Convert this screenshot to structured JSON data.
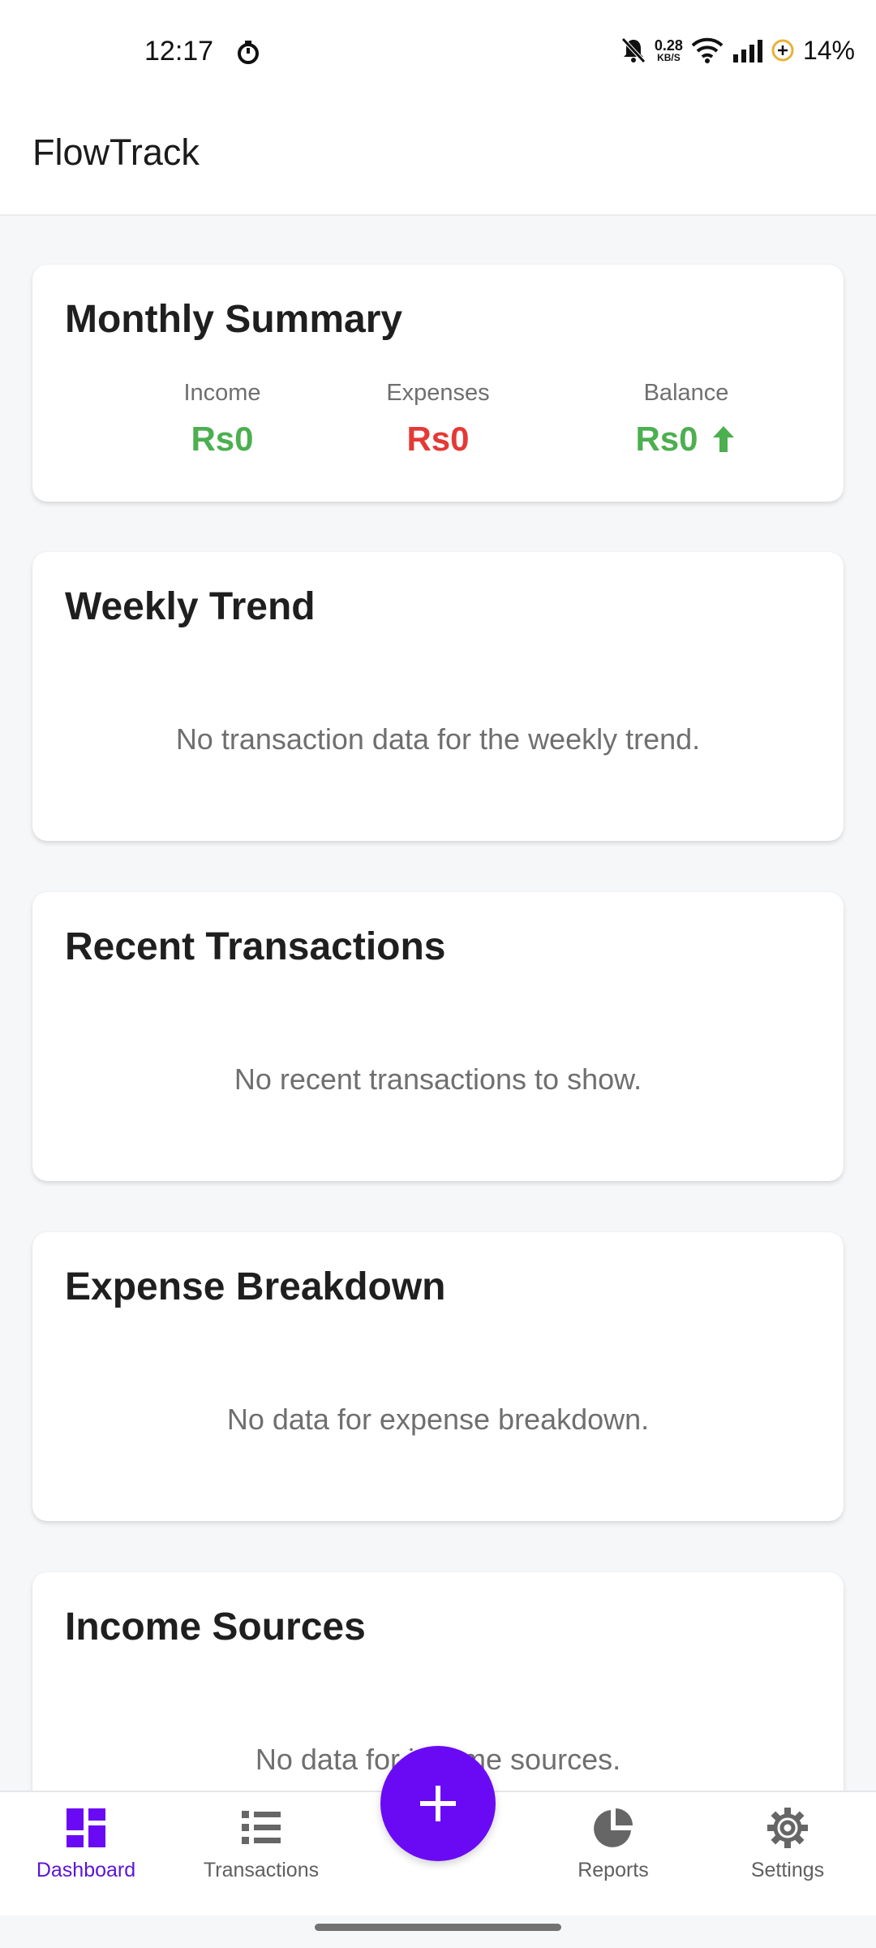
{
  "status_bar": {
    "time": "12:17",
    "net_speed_value": "0.28",
    "net_speed_unit": "KB/S",
    "battery": "14%",
    "icons": [
      "timer-icon",
      "mute-icon",
      "wifi-icon",
      "signal-icon",
      "battery-saver-icon"
    ]
  },
  "app": {
    "title": "FlowTrack"
  },
  "summary": {
    "title": "Monthly Summary",
    "income_label": "Income",
    "income_value": "Rs0",
    "expenses_label": "Expenses",
    "expenses_value": "Rs0",
    "balance_label": "Balance",
    "balance_value": "Rs0",
    "colors": {
      "positive": "#4caf50",
      "negative": "#e53935"
    }
  },
  "weekly_trend": {
    "title": "Weekly Trend",
    "empty": "No transaction data for the weekly trend."
  },
  "recent_transactions": {
    "title": "Recent Transactions",
    "empty": "No recent transactions to show."
  },
  "expense_breakdown": {
    "title": "Expense Breakdown",
    "empty": "No data for expense breakdown."
  },
  "income_sources": {
    "title": "Income Sources",
    "empty": "No data for income sources."
  },
  "nav": {
    "dashboard": "Dashboard",
    "transactions": "Transactions",
    "reports": "Reports",
    "settings": "Settings",
    "active": "Dashboard",
    "accent": "#6a0af5"
  }
}
